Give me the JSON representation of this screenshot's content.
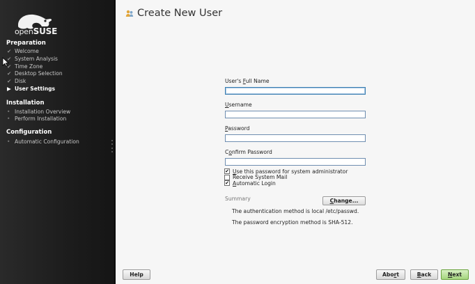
{
  "sidebar": {
    "logo_text_prefix": "open",
    "logo_text_bold": "SUSE",
    "sections": [
      {
        "title": "Preparation",
        "items": [
          {
            "label": "Welcome",
            "state": "done"
          },
          {
            "label": "System Analysis",
            "state": "done"
          },
          {
            "label": "Time Zone",
            "state": "done"
          },
          {
            "label": "Desktop Selection",
            "state": "done"
          },
          {
            "label": "Disk",
            "state": "done"
          },
          {
            "label": "User Settings",
            "state": "current"
          }
        ]
      },
      {
        "title": "Installation",
        "items": [
          {
            "label": "Installation Overview",
            "state": "pending"
          },
          {
            "label": "Perform Installation",
            "state": "pending"
          }
        ]
      },
      {
        "title": "Configuration",
        "items": [
          {
            "label": "Automatic Configuration",
            "state": "pending"
          }
        ]
      }
    ]
  },
  "main": {
    "title": "Create New User",
    "title_icon": "user-icon",
    "form": {
      "full_name": {
        "label_pre": "User's ",
        "label_accel": "F",
        "label_post": "ull Name",
        "value": ""
      },
      "username": {
        "label_pre": "",
        "label_accel": "U",
        "label_post": "sername",
        "value": ""
      },
      "password": {
        "label_pre": "",
        "label_accel": "P",
        "label_post": "assword",
        "value": ""
      },
      "confirm_password": {
        "label_pre": "C",
        "label_accel": "o",
        "label_post": "nfirm Password",
        "value": ""
      },
      "checkboxes": [
        {
          "label_pre": "",
          "label_accel": "U",
          "label_post": "se this password for system administrator",
          "checked": true
        },
        {
          "label_pre": "Receive System Mail",
          "label_accel": "",
          "label_post": "",
          "checked": false
        },
        {
          "label_pre": "",
          "label_accel": "A",
          "label_post": "utomatic Login",
          "checked": true
        }
      ],
      "summary_heading": "Summary",
      "summary_lines": [
        "The authentication method is local /etc/passwd.",
        "The password encryption method is SHA-512."
      ],
      "change_button": {
        "label_accel": "C",
        "label_post": "hange..."
      }
    }
  },
  "buttons": {
    "help": "Help",
    "abort": {
      "pre": "Abo",
      "accel": "r",
      "post": "t"
    },
    "back": {
      "pre": "",
      "accel": "B",
      "post": "ack"
    },
    "next": {
      "pre": "",
      "accel": "N",
      "post": "ext"
    }
  },
  "colors": {
    "sidebar_bg": "#1f1f1f",
    "main_bg": "#f6f6f6",
    "next_button": "#a5d67e",
    "input_border": "#6e8db0"
  }
}
